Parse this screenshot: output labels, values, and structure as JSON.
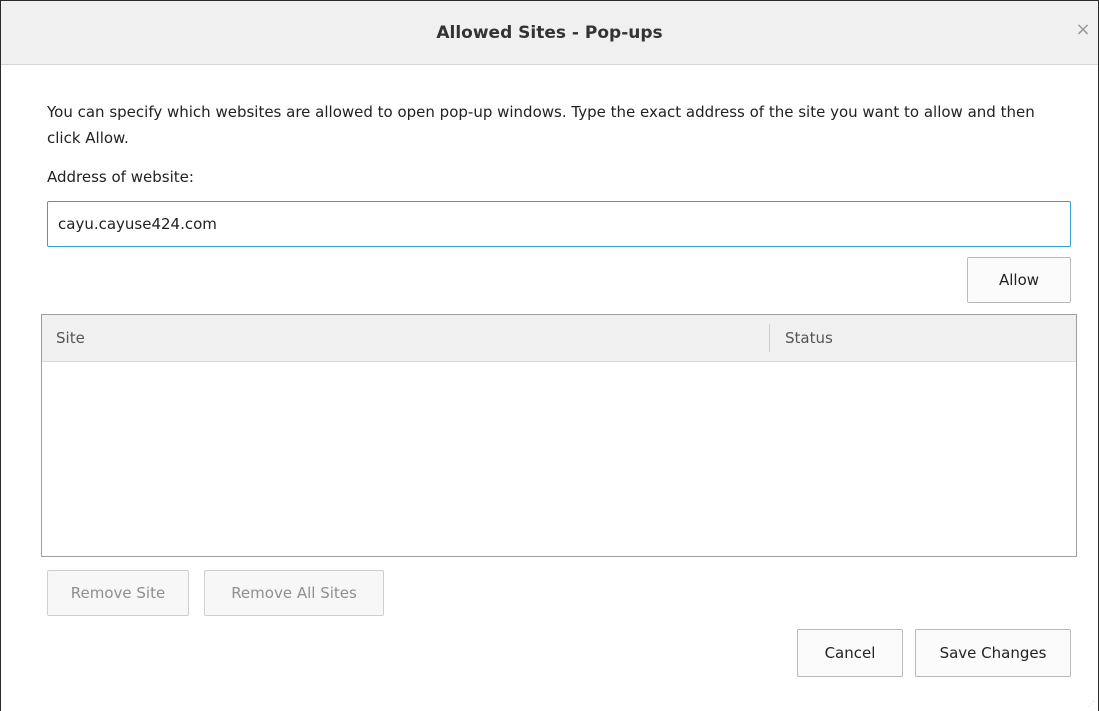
{
  "dialog": {
    "title": "Allowed Sites - Pop-ups",
    "close_glyph": "×"
  },
  "description": "You can specify which websites are allowed to open pop-up windows. Type the exact address of the site you want to allow and then click Allow.",
  "address": {
    "label": "Address of website:",
    "value": "cayu.cayuse424.com"
  },
  "buttons": {
    "allow": "Allow",
    "remove_site": "Remove Site",
    "remove_all_sites": "Remove All Sites",
    "cancel": "Cancel",
    "save_changes": "Save Changes"
  },
  "table": {
    "columns": [
      "Site",
      "Status"
    ],
    "rows": []
  },
  "colors": {
    "input_focus_border": "#34a0d8",
    "titlebar_bg": "#f0f0f0"
  }
}
